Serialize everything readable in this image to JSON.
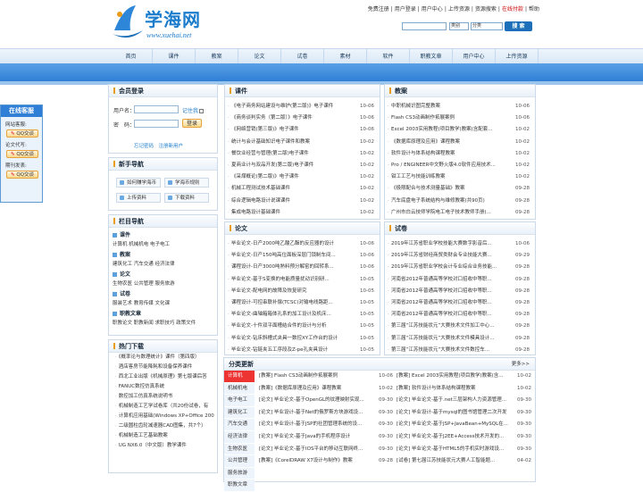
{
  "brand": {
    "title": "学海网",
    "url": "www.xuehai.net"
  },
  "toplinks": [
    {
      "label": "免费注册",
      "red": false
    },
    {
      "label": "用户登录",
      "red": false
    },
    {
      "label": "用户中心",
      "red": false
    },
    {
      "label": "上传资源",
      "red": false
    },
    {
      "label": "资源搜索",
      "red": false
    },
    {
      "label": "在线付款",
      "red": true
    },
    {
      "label": "帮助",
      "red": false
    }
  ],
  "search": {
    "select1": "类别",
    "select2": "分类",
    "button": "搜 索"
  },
  "nav": [
    "首页",
    "课件",
    "教案",
    "论文",
    "试卷",
    "素材",
    "软件",
    "职教文章",
    "用户中心",
    "上传资源"
  ],
  "float": {
    "title": "在线客服",
    "groups": [
      {
        "label": "网站客服:",
        "button": "QQ交谈"
      },
      {
        "label": "论文代写:",
        "button": "QQ交谈"
      },
      {
        "label": "期刊发表:",
        "button": "QQ交谈"
      }
    ]
  },
  "login": {
    "title": "会员登录",
    "user_label": "用户名：",
    "pwd_label": "密　码：",
    "remember": "记住我",
    "button": "登录",
    "links": "忘记密码　注册新用户"
  },
  "newbie": {
    "title": "新手导航",
    "buttons": [
      "如何赚学海币",
      "学海币规则",
      "上传资料",
      "下载资料"
    ]
  },
  "colnav": {
    "title": "栏目导航",
    "groups": [
      {
        "head": "课件",
        "items": "计算机 机械机电 电子电工"
      },
      {
        "head": "教案",
        "items": "建筑化工 汽车交通 经济法律"
      },
      {
        "head": "论文",
        "items": "生物农医 公共管理 服务旅游"
      },
      {
        "head": "试卷",
        "items": "服装艺术 教育传媒 文化课"
      },
      {
        "head": "职教文章",
        "items": "职教论文 职教新闻 求职技巧 政策文件"
      }
    ]
  },
  "hot": {
    "title": "热门下载",
    "items": [
      "《概率论与数理统计》课件（第四版）",
      "酒店客房节能降耗和设备保养课件",
      "西北工业出版《机械原理》第七版课后答",
      "FANUC数控仿真系统",
      "数控加工仿真系统说明书",
      "机械制造工艺学试卷库（共20份试卷，有",
      "计算机应用基础(Windows XP+Office 200",
      "二级圆柱齿轮减速器CAD图集，共7个）",
      "机械制造工艺基础教案",
      "UG NX6.0（中文版）教学课件"
    ]
  },
  "courseware": {
    "title": "课件",
    "rows": [
      {
        "t": "《电子商务网站建设与维护(第二版)》电子课件",
        "d": "10-06"
      },
      {
        "t": "《商务谈判实务（第二版）》电子课件",
        "d": "10-06"
      },
      {
        "t": "《网络营销(第三版)》电子课件",
        "d": "10-06"
      },
      {
        "t": "统计与会计基础知识电子课件和教案",
        "d": "10-02"
      },
      {
        "t": "餐饮业经营与管理(第二版)电子课件",
        "d": "10-02"
      },
      {
        "t": "夏商业计与双品开发(第二版)电子课件",
        "d": "10-02"
      },
      {
        "t": "《采煤概论(第二版)》电子课件",
        "d": "10-02"
      },
      {
        "t": "机械工程测试技术基础课件",
        "d": "10-02"
      },
      {
        "t": "综合逻辑电路设计说课课件",
        "d": "10-02"
      },
      {
        "t": "集成电路设计基础课件",
        "d": "10-02"
      }
    ]
  },
  "lessonplans": {
    "title": "教案",
    "rows": [
      {
        "t": "中职机械识图完整教案",
        "d": "10-06"
      },
      {
        "t": "Flash CS3动画制作拓展案例",
        "d": "10-06"
      },
      {
        "t": "Excel 2003实用教程(项目教学)教案(含配套...",
        "d": "10-02"
      },
      {
        "t": "《数据库原理及应用》课程教案",
        "d": "10-02"
      },
      {
        "t": "软件设计与体系结构课程教案",
        "d": "10-02"
      },
      {
        "t": "Pro / ENGINEER中文野火版4.0软件应用技术...",
        "d": "10-02"
      },
      {
        "t": "钳工工艺与技能训练教案",
        "d": "10-02"
      },
      {
        "t": "《极限配合与技术测量基础》教案",
        "d": "09-28"
      },
      {
        "t": "汽车底盘电子系统结构与维修教案(共90页)",
        "d": "09-28"
      },
      {
        "t": "广州市白云技师学院电工电子技术教师手册(...",
        "d": "09-28"
      }
    ]
  },
  "papers": {
    "title": "论文",
    "rows": [
      {
        "t": "毕业论文-日产2000吨乙酸乙酯的反应器的设计",
        "d": "10-06"
      },
      {
        "t": "毕业论文-日产150吨高位面板深层门锁制车间...",
        "d": "10-06"
      },
      {
        "t": "课程设计-日产3000吨熟料预分解窑的回转系...",
        "d": "10-06"
      },
      {
        "t": "毕业论文-基于S变换的电能质量扰动识别研...",
        "d": "10-05"
      },
      {
        "t": "毕业论文-配电网的故障及恢复研究",
        "d": "10-05"
      },
      {
        "t": "课程设计-可控串联补偿(TCSC)对输电线路距...",
        "d": "10-05"
      },
      {
        "t": "毕业论文-曲轴箱箱体孔系的加工设计及机床...",
        "d": "10-05"
      },
      {
        "t": "毕业论文-十件双平面槽结合件的设计与分析",
        "d": "10-05"
      },
      {
        "t": "毕业论文-钻床斜槽式夹具一数控XY工作台的设计",
        "d": "10-05"
      },
      {
        "t": "毕业论文-钻链夹五工序段及Z-pe孔夹具设计",
        "d": "10-05"
      }
    ]
  },
  "exams": {
    "title": "试卷",
    "rows": [
      {
        "t": "2019年江苏省职业学校技能大赛数字影音后...",
        "d": "10-06"
      },
      {
        "t": "2019年江苏省财经商贸类财会专业技能大赛...",
        "d": "09-29"
      },
      {
        "t": "2019年江苏省职业学校会计专业综合业务技能...",
        "d": "09-28"
      },
      {
        "t": "河南省2012年普通高等学校对口招收中等职...",
        "d": "09-28"
      },
      {
        "t": "河南省2012年普通高等学校对口招收中等职...",
        "d": "09-28"
      },
      {
        "t": "河南省2012年普通高等学校对口招收中等职...",
        "d": "09-28"
      },
      {
        "t": "河南省2012年普通高等学校对口招收中等职...",
        "d": "09-28"
      },
      {
        "t": "第三届“江苏技能状元”大赛技术文件加工中心...",
        "d": "09-28"
      },
      {
        "t": "第三届“江苏技能状元”大赛技术文件模具设计...",
        "d": "09-28"
      },
      {
        "t": "第三届“江苏技能状元”大赛技术文件数控车...",
        "d": "09-28"
      }
    ]
  },
  "categories": {
    "title": "分类更新",
    "more": "更多>>",
    "tabs": [
      "计算机",
      "机械机电",
      "电子电工",
      "建筑化工",
      "汽车交通",
      "经济法律",
      "生物农医",
      "公共管理",
      "服务旅游",
      "职教文章"
    ],
    "rows": [
      {
        "c1": "[教案] Flash CS3动画制作拓展案例",
        "d1": "10-06",
        "c2": "[教案] Excel 2003实用教程(项目教学)教案(含...",
        "d2": "10-02"
      },
      {
        "c1": "[教案]《数据库原理及应用》课程教案",
        "d1": "10-02",
        "c2": "[教案] 软件设计与体系结构课程教案",
        "d2": "10-02"
      },
      {
        "c1": "[论文] 毕业论文-基于OpenGL的纹理映射实现...",
        "d1": "09-30",
        "c2": "[论文] 毕业论文-基于.net三层架构人力资源管理...",
        "d2": "09-30"
      },
      {
        "c1": "[论文] 毕业设计-基于Net的俄罗斯方块游戏设...",
        "d1": "09-30",
        "c2": "[论文] 毕业设计-基于mysql的图书馆管理二次开发",
        "d2": "09-30"
      },
      {
        "c1": "[论文] 毕业设计-基于JSP的社团管理系统的设...",
        "d1": "09-30",
        "c2": "[论文] 毕业论文-基于JSP+JavaBean+MySQL在...",
        "d2": "09-30"
      },
      {
        "c1": "[论文] 毕业论文-基于Java的手机程序设计",
        "d1": "09-30",
        "c2": "[论文] 毕业论文-基于J2EE+Access技术开发的...",
        "d2": "09-30"
      },
      {
        "c1": "[论文] 毕业论文-基于IOS平台的移动互联网终...",
        "d1": "09-30",
        "c2": "[论文] 毕业论文-基于HTML5的手机实时游戏设...",
        "d2": "09-30"
      },
      {
        "c1": "[教案]《CorelDRAW X7设计与制作》教案",
        "d1": "09-28",
        "c2": "[试卷] 第七届江苏技能状元大赛人工智能题...",
        "d2": "04-02"
      }
    ]
  }
}
